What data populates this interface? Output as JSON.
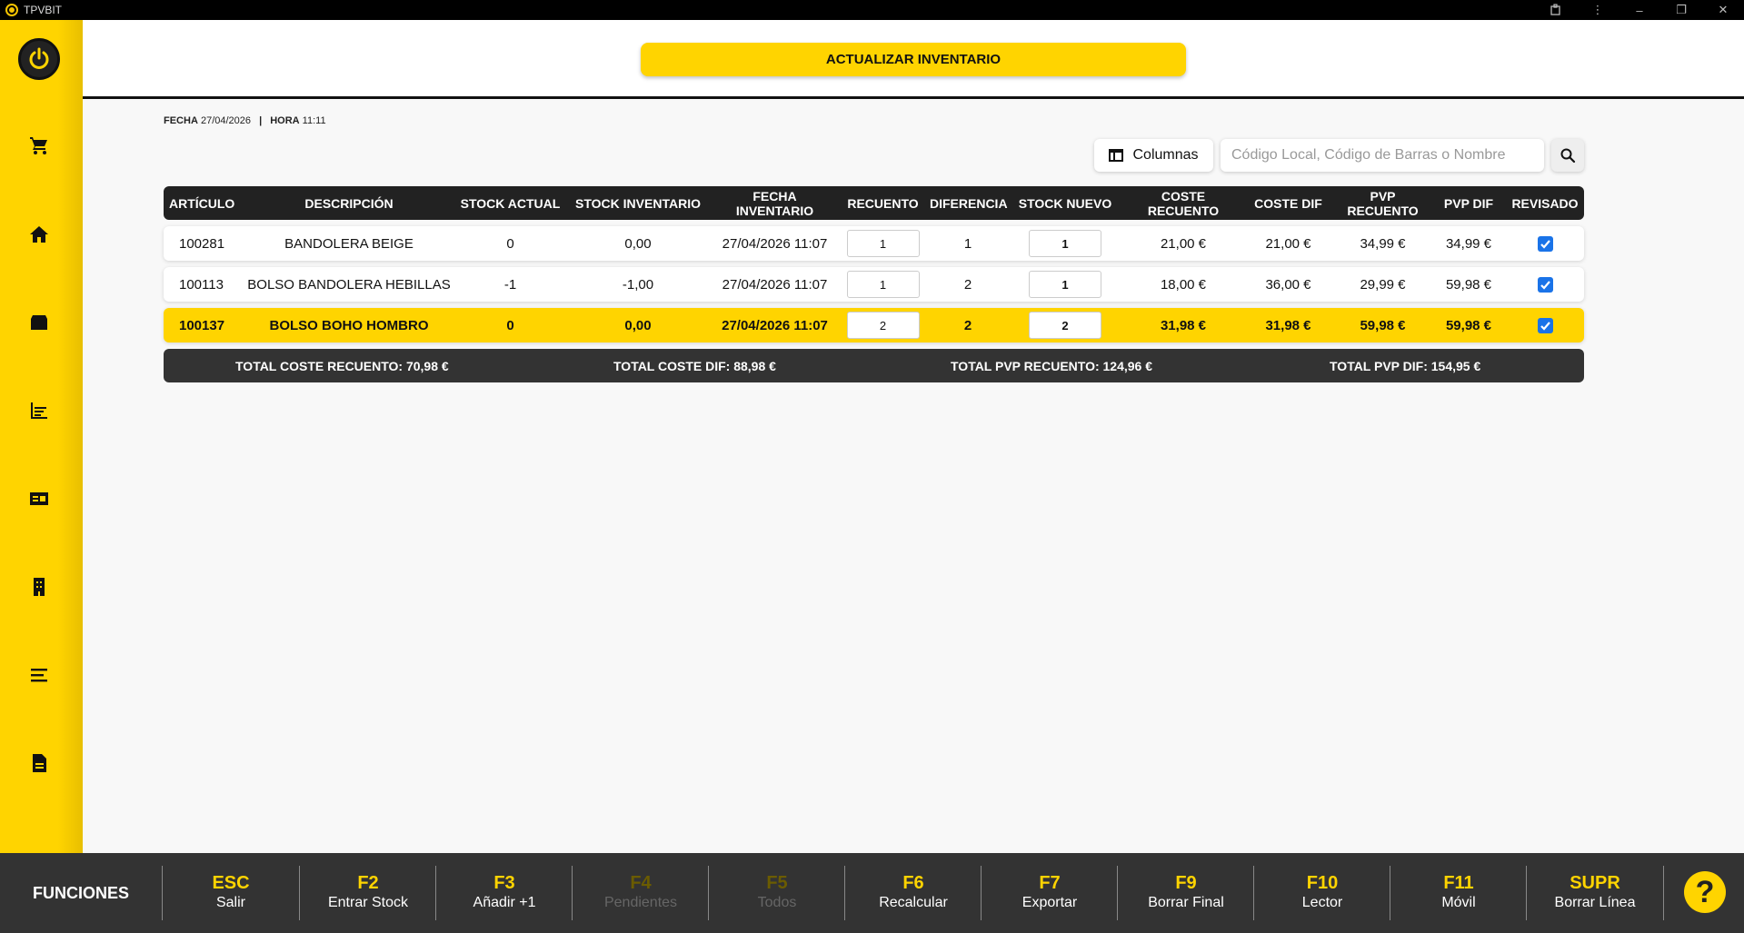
{
  "window": {
    "title": "TPVBIT"
  },
  "header": {
    "update_button": "ACTUALIZAR INVENTARIO"
  },
  "dateinfo": {
    "fecha_label": "FECHA",
    "fecha": "27/04/2026",
    "separator": "|",
    "hora_label": "HORA",
    "hora": "11:11"
  },
  "tools": {
    "columns_label": "Columnas",
    "search_placeholder": "Código Local, Código de Barras o Nombre"
  },
  "table": {
    "headers": [
      "ARTÍCULO",
      "DESCRIPCIÓN",
      "STOCK ACTUAL",
      "STOCK INVENTARIO",
      "FECHA INVENTARIO",
      "RECUENTO",
      "DIFERENCIA",
      "STOCK NUEVO",
      "COSTE RECUENTO",
      "COSTE DIF",
      "PVP RECUENTO",
      "PVP DIF",
      "REVISADO"
    ],
    "rows": [
      {
        "articulo": "100281",
        "descripcion": "BANDOLERA BEIGE",
        "stock_actual": "0",
        "stock_inventario": "0,00",
        "fecha_inventario": "27/04/2026 11:07",
        "recuento": "1",
        "diferencia": "1",
        "stock_nuevo": "1",
        "coste_recuento": "21,00 €",
        "coste_dif": "21,00 €",
        "pvp_recuento": "34,99 €",
        "pvp_dif": "34,99 €",
        "revisado": true
      },
      {
        "articulo": "100113",
        "descripcion": "BOLSO BANDOLERA HEBILLAS",
        "stock_actual": "-1",
        "stock_inventario": "-1,00",
        "fecha_inventario": "27/04/2026 11:07",
        "recuento": "1",
        "diferencia": "2",
        "stock_nuevo": "1",
        "coste_recuento": "18,00 €",
        "coste_dif": "36,00 €",
        "pvp_recuento": "29,99 €",
        "pvp_dif": "59,98 €",
        "revisado": true
      },
      {
        "articulo": "100137",
        "descripcion": "BOLSO BOHO HOMBRO",
        "stock_actual": "0",
        "stock_inventario": "0,00",
        "fecha_inventario": "27/04/2026 11:07",
        "recuento": "2",
        "diferencia": "2",
        "stock_nuevo": "2",
        "coste_recuento": "31,98 €",
        "coste_dif": "31,98 €",
        "pvp_recuento": "59,98 €",
        "pvp_dif": "59,98 €",
        "revisado": true
      }
    ],
    "totals": {
      "coste_recuento": "TOTAL COSTE RECUENTO: 70,98 €",
      "coste_dif": "TOTAL COSTE DIF: 88,98 €",
      "pvp_recuento": "TOTAL PVP RECUENTO: 124,96 €",
      "pvp_dif": "TOTAL PVP DIF: 154,95 €"
    }
  },
  "sidebar": {
    "icons": [
      "cart-icon",
      "home-icon",
      "box-icon",
      "chart-icon",
      "id-card-icon",
      "building-icon",
      "menu-icon",
      "document-icon"
    ]
  },
  "functions": {
    "label": "FUNCIONES",
    "keys": [
      {
        "key": "ESC",
        "label": "Salir",
        "enabled": true
      },
      {
        "key": "F2",
        "label": "Entrar Stock",
        "enabled": true
      },
      {
        "key": "F3",
        "label": "Añadir +1",
        "enabled": true
      },
      {
        "key": "F4",
        "label": "Pendientes",
        "enabled": false
      },
      {
        "key": "F5",
        "label": "Todos",
        "enabled": false
      },
      {
        "key": "F6",
        "label": "Recalcular",
        "enabled": true
      },
      {
        "key": "F7",
        "label": "Exportar",
        "enabled": true
      },
      {
        "key": "F9",
        "label": "Borrar Final",
        "enabled": true
      },
      {
        "key": "F10",
        "label": "Lector",
        "enabled": true
      },
      {
        "key": "F11",
        "label": "Móvil",
        "enabled": true
      },
      {
        "key": "SUPR",
        "label": "Borrar Línea",
        "enabled": true
      }
    ],
    "help": "?"
  },
  "colors": {
    "accent": "#ffd400",
    "dark": "#222222",
    "checkbox": "#1a73e8"
  }
}
